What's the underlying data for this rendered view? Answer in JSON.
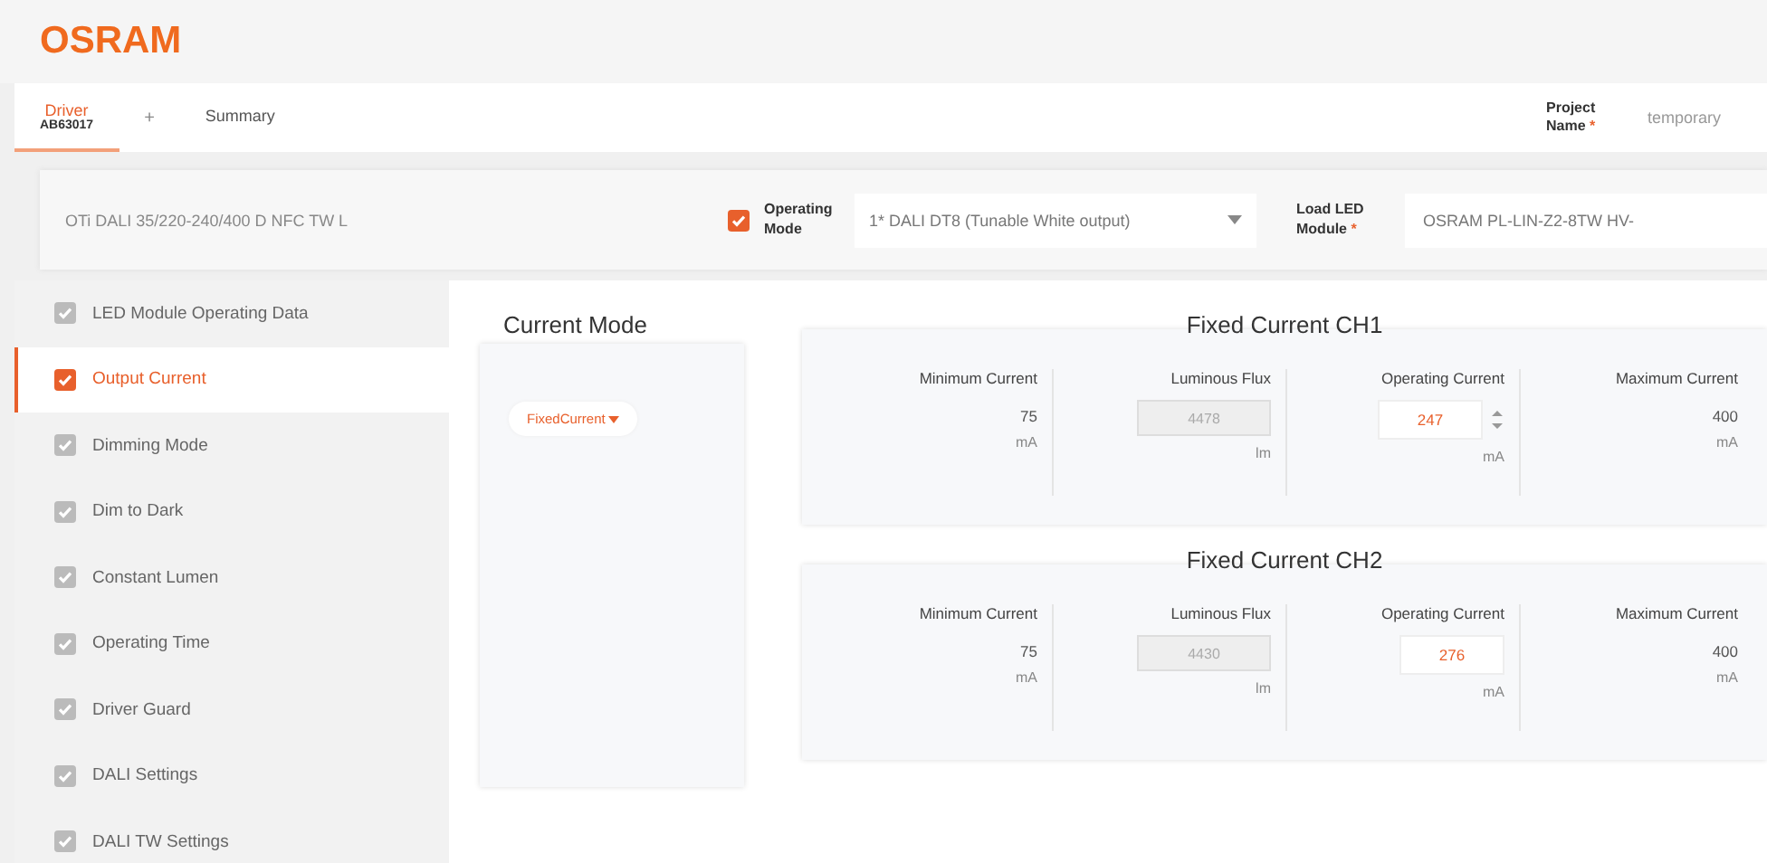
{
  "logo": "OSRAM",
  "tabs": [
    {
      "label": "Driver",
      "sublabel": "AB63017",
      "selected": true
    },
    {
      "label": "Summary",
      "selected": false
    }
  ],
  "add_tab": "+",
  "project": {
    "label": "Project Name",
    "required": "*",
    "value": "temporary"
  },
  "config": {
    "driver": "OTi DALI 35/220-240/400 D NFC TW L",
    "mode_checked": true,
    "mode_label": "Operating Mode",
    "mode_value": "1* DALI DT8 (Tunable White output)",
    "module_label": "Load LED Module",
    "module_required": "*",
    "module_value": "OSRAM PL-LIN-Z2-8TW HV-"
  },
  "sidebar": {
    "items": [
      {
        "label": "LED Module Operating Data",
        "checked": true,
        "selected": false
      },
      {
        "label": "Output Current",
        "checked": true,
        "selected": true
      },
      {
        "label": "Dimming Mode",
        "checked": true,
        "selected": false
      },
      {
        "label": "Dim to Dark",
        "checked": true,
        "selected": false
      },
      {
        "label": "Constant Lumen",
        "checked": true,
        "selected": false
      },
      {
        "label": "Operating Time",
        "checked": true,
        "selected": false
      },
      {
        "label": "Driver Guard",
        "checked": true,
        "selected": false
      },
      {
        "label": "DALI Settings",
        "checked": true,
        "selected": false
      },
      {
        "label": "DALI TW Settings",
        "checked": true,
        "selected": false
      }
    ]
  },
  "current_mode": {
    "title": "Current Mode",
    "value": "FixedCurrent"
  },
  "channels": [
    {
      "title": "Fixed Current CH1",
      "columns": [
        {
          "kind": "readout",
          "label": "Minimum Current",
          "value": "75",
          "unit": "mA"
        },
        {
          "kind": "readonly",
          "label": "Luminous Flux",
          "value": "4478",
          "unit": "lm"
        },
        {
          "kind": "spin",
          "label": "Operating Current",
          "value": "247",
          "unit": "mA",
          "spinner": true
        },
        {
          "kind": "readout",
          "label": "Maximum Current",
          "value": "400",
          "unit": "mA"
        }
      ]
    },
    {
      "title": "Fixed Current CH2",
      "columns": [
        {
          "kind": "readout",
          "label": "Minimum Current",
          "value": "75",
          "unit": "mA"
        },
        {
          "kind": "readonly",
          "label": "Luminous Flux",
          "value": "4430",
          "unit": "lm"
        },
        {
          "kind": "spin",
          "label": "Operating Current",
          "value": "276",
          "unit": "mA",
          "spinner": false
        },
        {
          "kind": "readout",
          "label": "Maximum Current",
          "value": "400",
          "unit": "mA"
        }
      ]
    }
  ]
}
